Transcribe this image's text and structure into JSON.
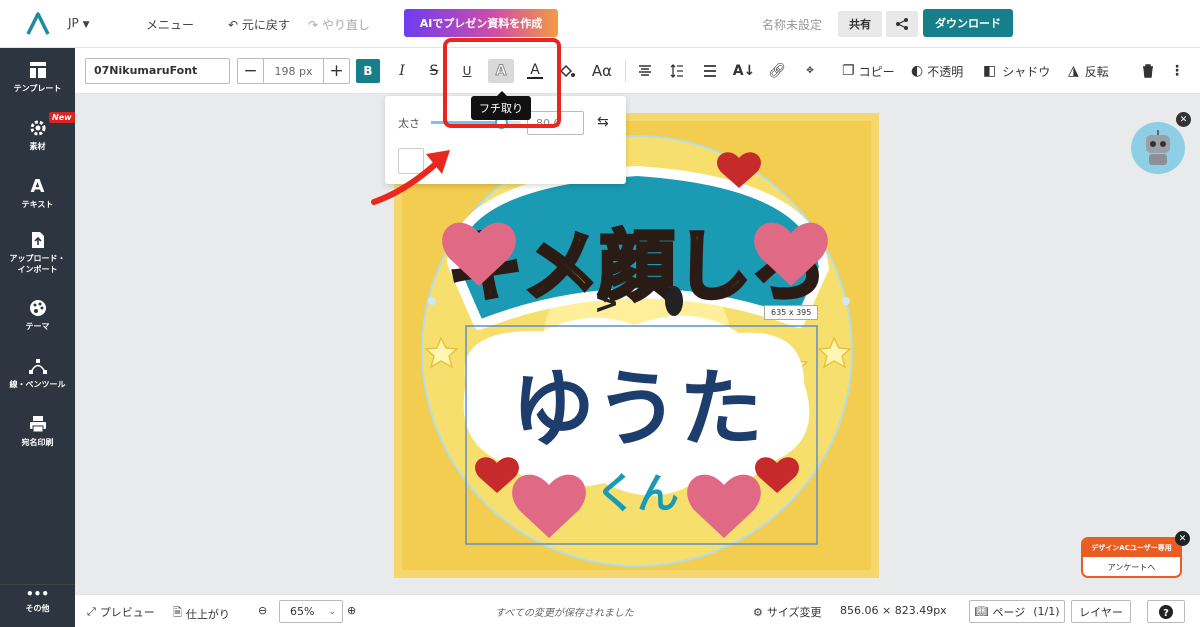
{
  "header": {
    "language": "JP",
    "menu": "メニュー",
    "undo": "元に戻す",
    "redo": "やり直し",
    "ai_button": "AIでプレゼン資料を作成",
    "doc_name": "名称未設定",
    "share": "共有",
    "download": "ダウンロード"
  },
  "sidebar": {
    "items": [
      {
        "label": "テンプレート",
        "icon": "template-icon"
      },
      {
        "label": "素材",
        "icon": "gear-icon",
        "badge": "New"
      },
      {
        "label": "テキスト",
        "icon": "text-icon"
      },
      {
        "label": "アップロード・\nインポート",
        "icon": "upload-icon"
      },
      {
        "label": "テーマ",
        "icon": "palette-icon"
      },
      {
        "label": "線・ペンツール",
        "icon": "pen-tool-icon"
      },
      {
        "label": "宛名印刷",
        "icon": "printer-icon"
      },
      {
        "label": "その他",
        "icon": "more-icon"
      }
    ]
  },
  "toolbar": {
    "font_name": "07NikumaruFont",
    "font_size": "198 px",
    "copy": "コピー",
    "opacity": "不透明",
    "shadow": "シャドウ",
    "flip": "反転"
  },
  "outline_popup": {
    "label": "太さ",
    "value": "80.0",
    "slider_fraction": 0.78,
    "tooltip": "フチ取り"
  },
  "canvas": {
    "selection_size": "635 x 395",
    "design_title": "キメ顔しろ",
    "design_name": "ゆうた",
    "design_suffix": "くん"
  },
  "survey": {
    "title": "デザインACユーザー専用",
    "button": "アンケートへ"
  },
  "bottom": {
    "preview": "プレビュー",
    "finish": "仕上がり",
    "zoom": "65%",
    "saved": "すべての変更が保存されました",
    "resize": "サイズ変更",
    "dimensions": "856.06 × 823.49px",
    "page": "ページ",
    "page_count": "(1/1)",
    "layer": "レイヤー"
  },
  "colors": {
    "accent": "#16808a",
    "sidebar_bg": "#2d3540",
    "highlight": "#e8281f",
    "badge_red": "#dd2222"
  }
}
